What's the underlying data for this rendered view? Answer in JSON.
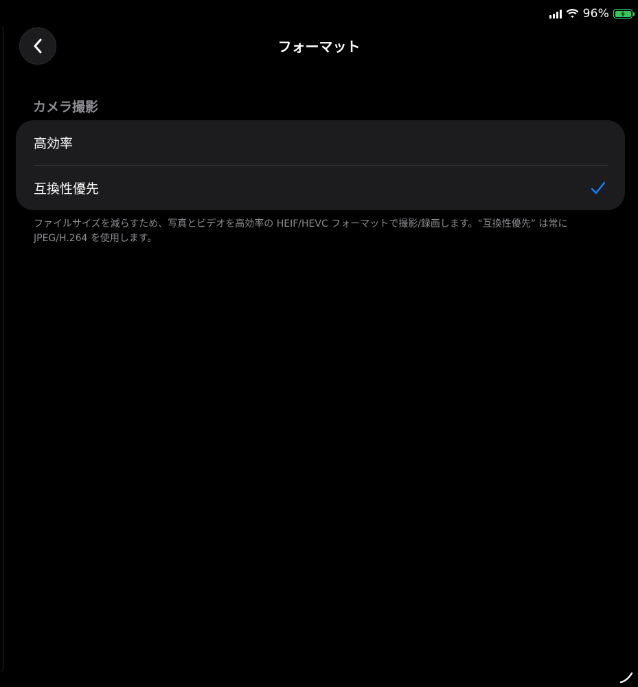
{
  "status_bar": {
    "battery_percent": "96%",
    "battery_charging": true,
    "signal_bars": 4,
    "wifi": true
  },
  "nav": {
    "back_icon": "chevron-left-icon",
    "title": "フォーマット"
  },
  "section": {
    "header": "カメラ撮影",
    "options": [
      {
        "label": "高効率",
        "selected": false
      },
      {
        "label": "互換性優先",
        "selected": true
      }
    ],
    "footer": "ファイルサイズを減らすため、写真とビデオを高効率の HEIF/HEVC フォーマットで撮影/録画します。“互換性優先” は常に JPEG/H.264 を使用します。"
  },
  "colors": {
    "background": "#000000",
    "group_background": "#1c1c1e",
    "accent": "#0a84ff",
    "secondary_text": "#8e8e93",
    "battery_green": "#34c759"
  }
}
